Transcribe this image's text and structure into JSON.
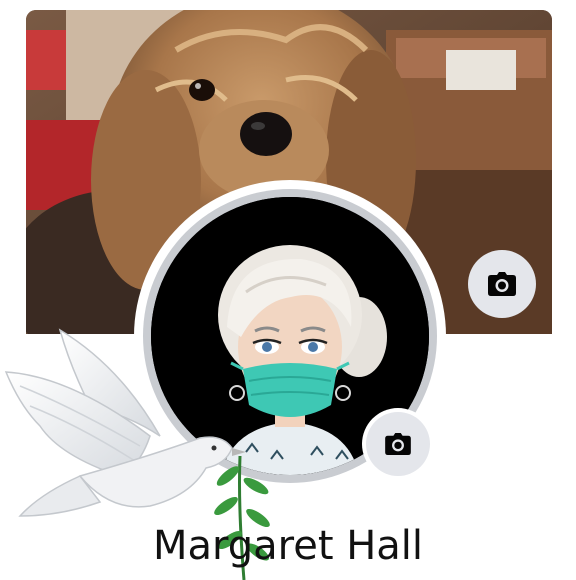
{
  "profile": {
    "name": "Margaret Hall"
  },
  "icons": {
    "cover_camera": "camera-icon",
    "profile_camera": "camera-icon",
    "dove": "dove-with-olive-branch"
  },
  "colors": {
    "camera_button_bg": "#e4e6eb",
    "profile_frame": "#c9ccd1",
    "name_text": "#111111",
    "mask": "#3ec8b4"
  }
}
